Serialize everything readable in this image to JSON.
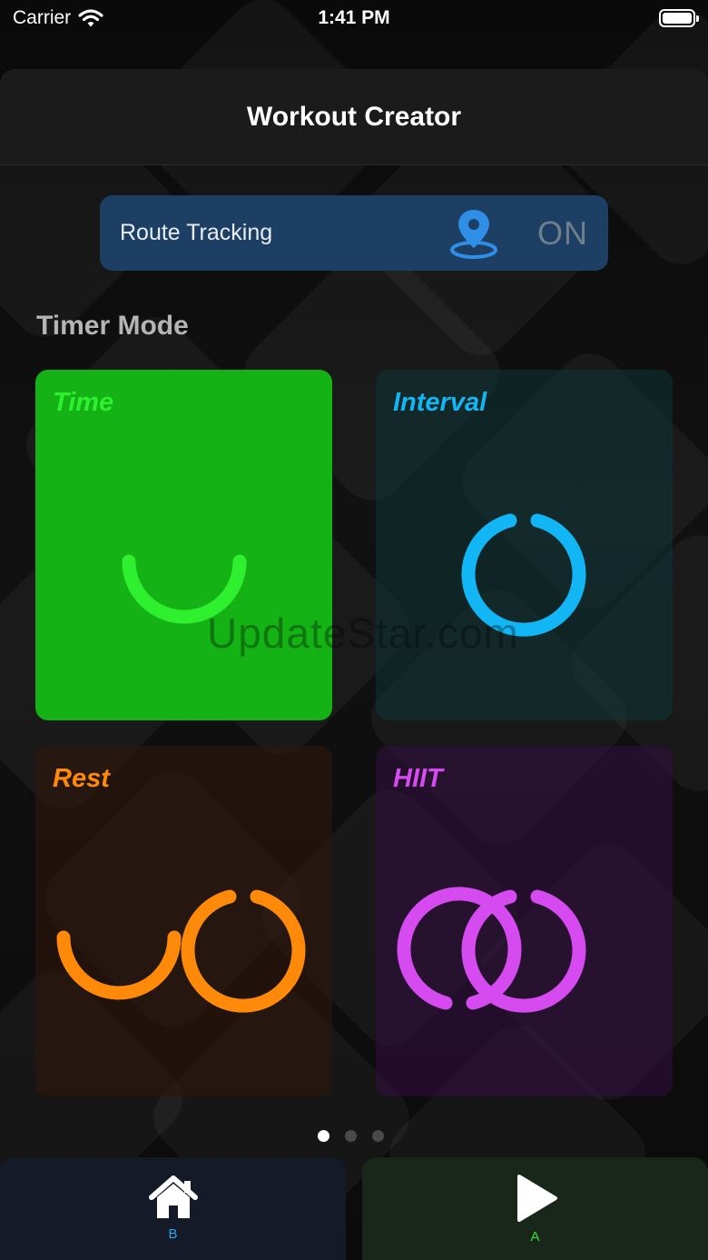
{
  "status_bar": {
    "carrier": "Carrier",
    "time": "1:41 PM"
  },
  "header": {
    "title": "Workout Creator"
  },
  "route_tracking": {
    "label": "Route Tracking",
    "icon": "location-pin-icon",
    "state": "ON"
  },
  "timer_mode": {
    "title": "Timer Mode",
    "modes": [
      {
        "label": "Time",
        "color": "#2ef02e",
        "icon": "time-arc-icon"
      },
      {
        "label": "Interval",
        "color": "#12b6f4",
        "icon": "interval-ring-icon"
      },
      {
        "label": "Rest",
        "color": "#ff8a0a",
        "icon": "rest-rings-icon"
      },
      {
        "label": "HIIT",
        "color": "#d54bf0",
        "icon": "hiit-rings-icon"
      }
    ]
  },
  "watermark": "UpdateStar.com",
  "pager": {
    "count": 3,
    "active": 1
  },
  "tab_bar": {
    "home": {
      "label": "B",
      "icon": "home-icon"
    },
    "play": {
      "label": "A",
      "icon": "play-icon"
    }
  },
  "colors": {
    "route_card": "#1c3f63",
    "time_card": "#15b215",
    "header": "#1b1b1b"
  }
}
